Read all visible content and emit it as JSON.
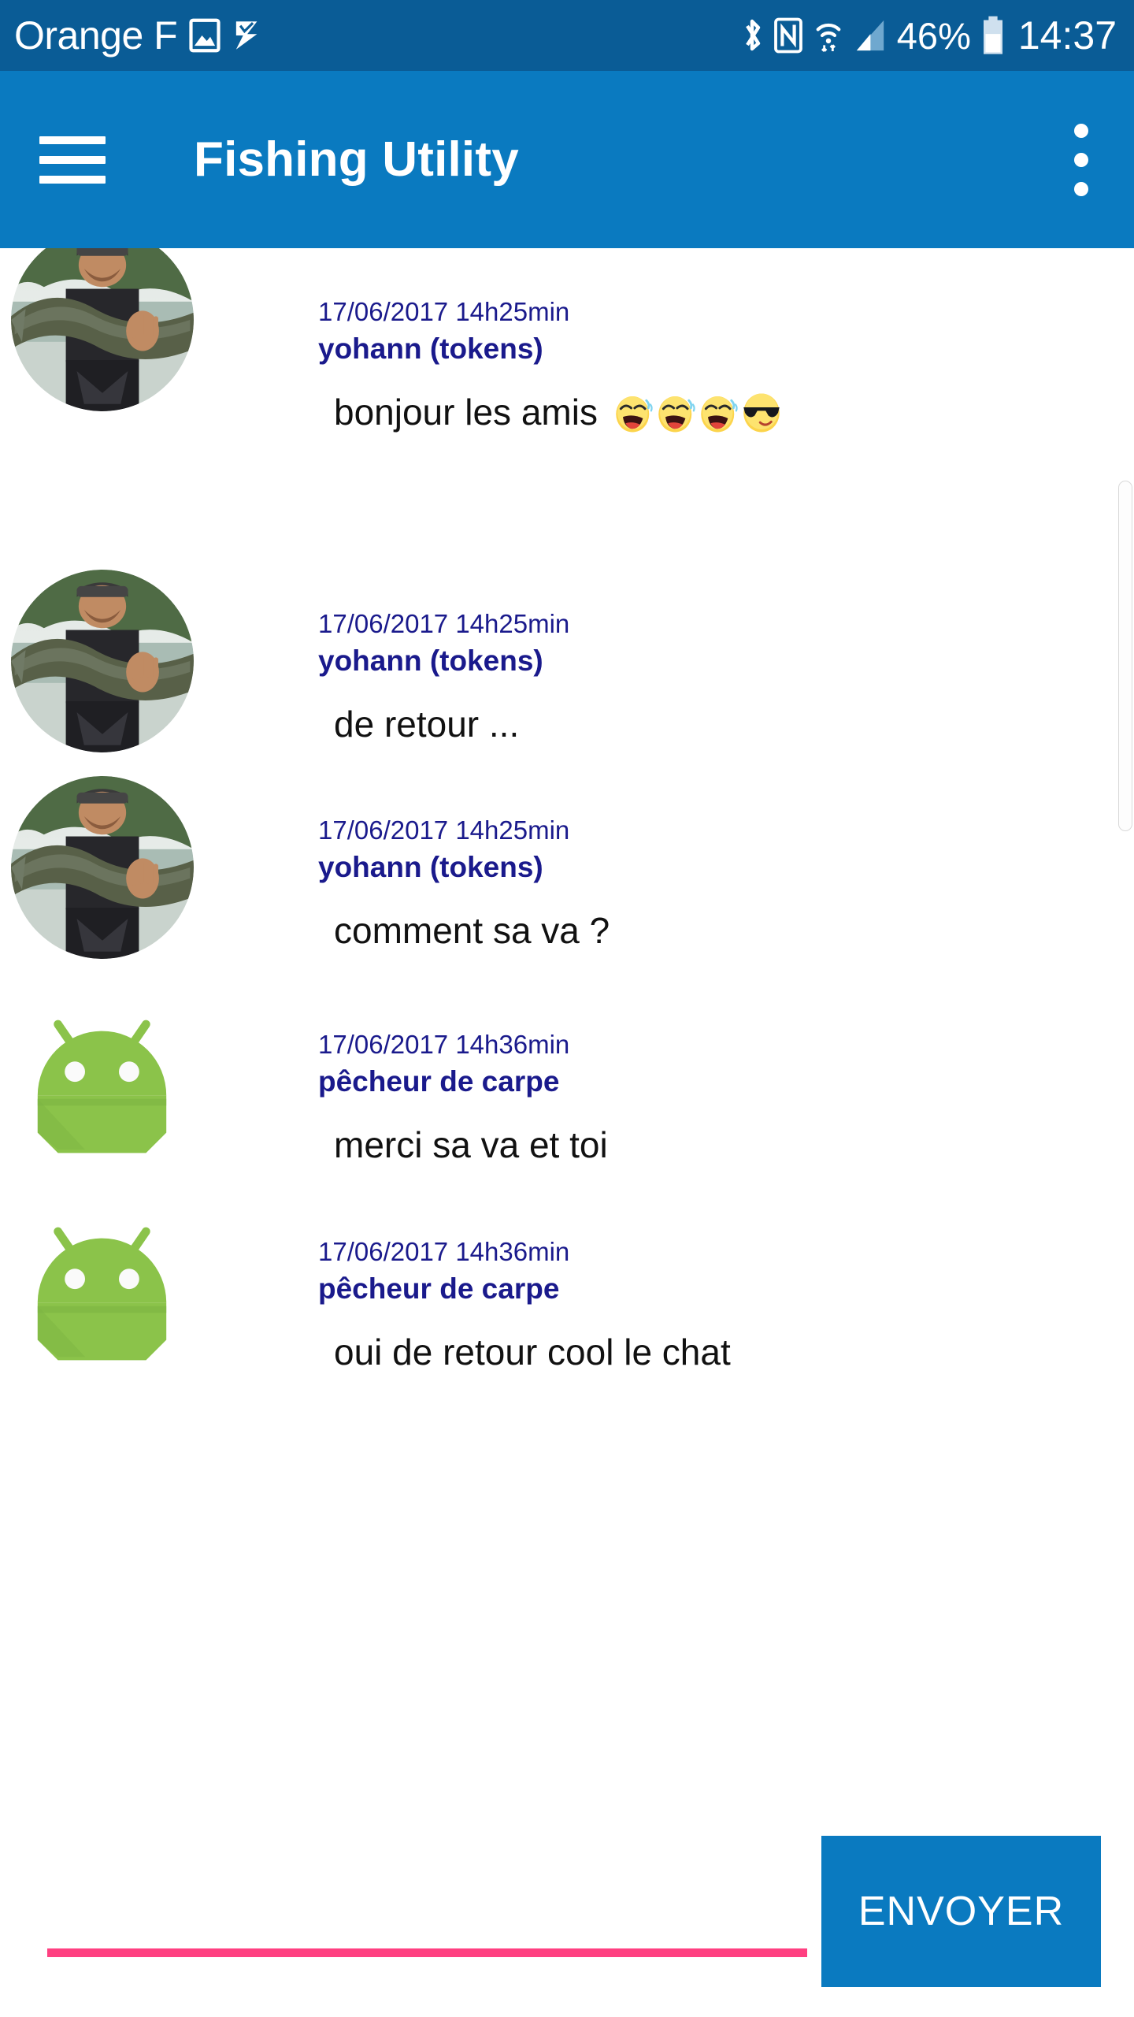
{
  "theme": {
    "statusbar_color": "#0a5c96",
    "appbar_color": "#0a7ac0",
    "accent_color": "#ff4081",
    "meta_text_color": "#1a1a8c",
    "message_text_color": "#111111",
    "android_green": "#8bc34a"
  },
  "status_bar": {
    "carrier": "Orange F",
    "icons_left": [
      "image-icon",
      "tasks-check-icon"
    ],
    "icons_right": [
      "bluetooth-icon",
      "nfc-icon",
      "wifi-icon",
      "signal-icon"
    ],
    "battery_percent": "46%",
    "battery_icon": "battery-icon",
    "clock": "14:37"
  },
  "app_bar": {
    "menu_icon": "hamburger-icon",
    "title": "Fishing Utility",
    "overflow_icon": "overflow-menu-icon"
  },
  "messages": [
    {
      "timestamp": "17/06/2017 14h25min",
      "username": "yohann (tokens)",
      "text": "bonjour les amis",
      "emojis": [
        "rofl",
        "rofl",
        "rofl",
        "sunglasses"
      ],
      "avatar": "photo-fisherman-with-pike"
    },
    {
      "timestamp": "17/06/2017 14h25min",
      "username": "yohann (tokens)",
      "text": "de retour ...",
      "emojis": [],
      "avatar": "photo-fisherman-with-pike"
    },
    {
      "timestamp": "17/06/2017 14h25min",
      "username": "yohann (tokens)",
      "text": "comment sa va ?",
      "emojis": [],
      "avatar": "photo-fisherman-with-pike"
    },
    {
      "timestamp": "17/06/2017 14h36min",
      "username": "pêcheur de carpe",
      "text": "merci sa va et toi",
      "emojis": [],
      "avatar": "android-robot-icon"
    },
    {
      "timestamp": "17/06/2017 14h36min",
      "username": "pêcheur de carpe",
      "text": "oui de retour cool le chat",
      "emojis": [],
      "avatar": "android-robot-icon"
    }
  ],
  "composer": {
    "input_value": "",
    "input_placeholder": "",
    "send_label": "ENVOYER"
  }
}
